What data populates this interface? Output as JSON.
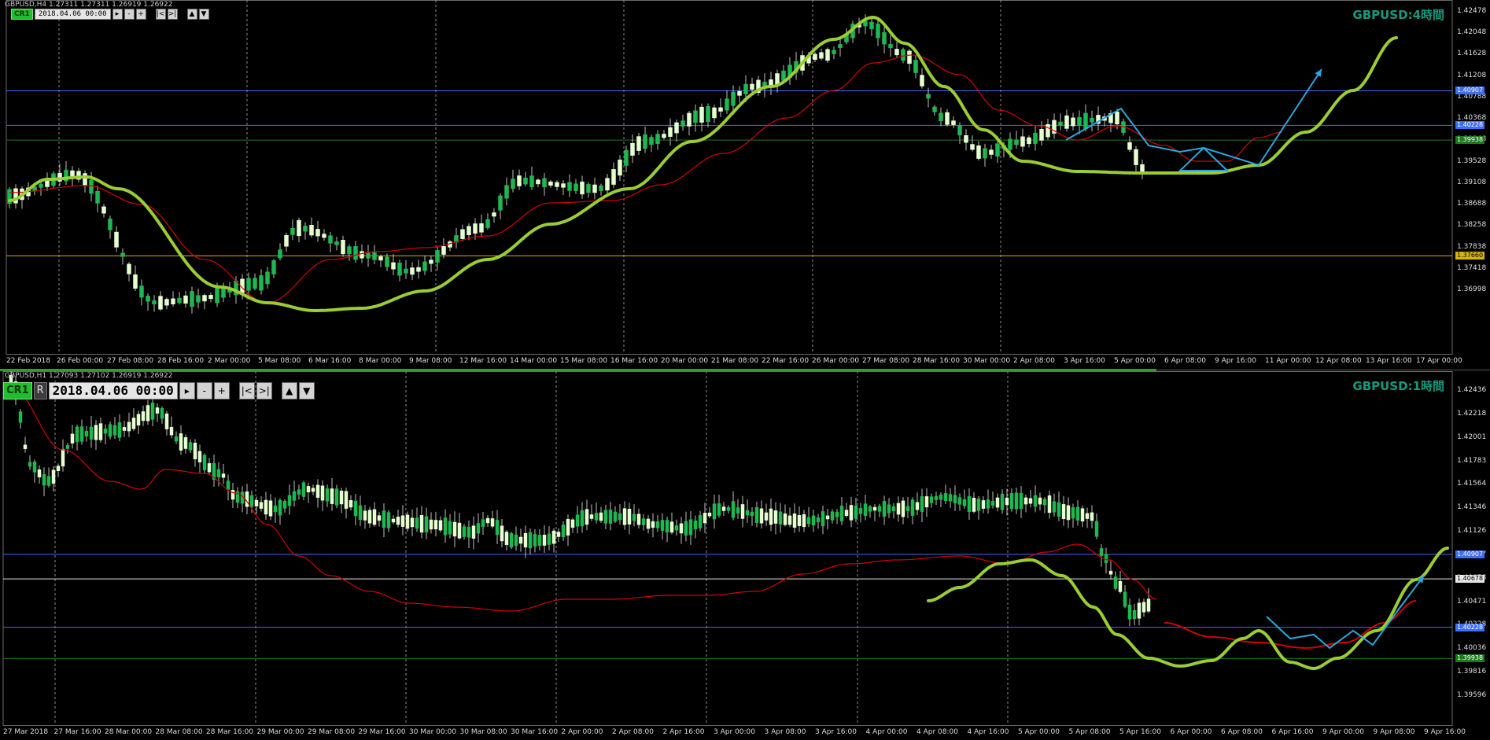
{
  "colors": {
    "background": "#000000",
    "candle_body": "#1db851",
    "candle_wick": "#bfbfbf",
    "candle_bear": "#e6ffd0",
    "ma_red": "#d40000",
    "trend_lime": "#9acd32",
    "projection_blue": "#2aa7df",
    "level_blue": "#3f6ef6",
    "level_green": "#1c7a1c",
    "level_yellow": "#d6b500",
    "level_white": "#e8e8e8",
    "title_teal": "#149a7e",
    "grid": "#8c8c8c"
  },
  "top": {
    "symbol_info": "GBPUSD,H4  1.27311 1.27311 1.26919 1.26922",
    "title": "GBPUSD:4時間",
    "toolbar": {
      "cr": "CR1",
      "date": "2018.04.06 00:00",
      "buttons": [
        "▸",
        "-",
        "+",
        "|<",
        ">|",
        "▲",
        "▼"
      ]
    },
    "y_labels": [
      "1.42478",
      "1.42048",
      "1.41628",
      "1.41208",
      "1.40788",
      "1.40368",
      "1.39948",
      "1.39528",
      "1.39108",
      "1.38688",
      "1.38258",
      "1.37838",
      "1.37418",
      "1.36998"
    ],
    "price_tags": [
      {
        "label": "1.40907",
        "price": 1.40907,
        "color": "#3f6ef6"
      },
      {
        "label": "1.40228",
        "price": 1.40228,
        "color": "#3f6ef6"
      },
      {
        "label": "1.39938",
        "price": 1.39938,
        "color": "#1c7a1c"
      },
      {
        "label": "1.37660",
        "price": 1.3766,
        "color": "#d6b500"
      }
    ],
    "x_labels": [
      "22 Feb 2018",
      "26 Feb 00:00",
      "27 Feb 08:00",
      "28 Feb 16:00",
      "2 Mar 00:00",
      "5 Mar 08:00",
      "6 Mar 16:00",
      "8 Mar 00:00",
      "9 Mar 08:00",
      "12 Mar 16:00",
      "14 Mar 00:00",
      "15 Mar 08:00",
      "16 Mar 16:00",
      "20 Mar 00:00",
      "21 Mar 08:00",
      "22 Mar 16:00",
      "26 Mar 00:00",
      "27 Mar 08:00",
      "28 Mar 16:00",
      "30 Mar 00:00",
      "2 Apr 08:00",
      "3 Apr 16:00",
      "5 Apr 00:00",
      "6 Apr 08:00",
      "9 Apr 16:00",
      "11 Apr 00:00",
      "12 Apr 08:00",
      "13 Apr 16:00",
      "17 Apr 00:00"
    ]
  },
  "bottom": {
    "symbol_info": "GBPUSD,H1  1.27093 1.27102 1.26919 1.26922",
    "title": "GBPUSD:1時間",
    "toolbar": {
      "cr": "CR1",
      "r": "R",
      "date": "2018.04.06 00:00",
      "buttons": [
        "▸",
        "-",
        "+",
        "|<",
        ">|",
        "▲",
        "▼"
      ]
    },
    "y_labels": [
      "1.42436",
      "1.42218",
      "1.42001",
      "1.41783",
      "1.41564",
      "1.41346",
      "1.41126",
      "1.40907",
      "1.40678",
      "1.40471",
      "1.40228",
      "1.40036",
      "1.39816",
      "1.39596"
    ],
    "price_tags": [
      {
        "label": "1.40907",
        "price": 1.40907,
        "color": "#3f6ef6"
      },
      {
        "label": "1.40678",
        "price": 1.40678,
        "color": "#e8e8e8"
      },
      {
        "label": "1.40228",
        "price": 1.40228,
        "color": "#3f6ef6"
      },
      {
        "label": "1.39938",
        "price": 1.39938,
        "color": "#1c7a1c"
      }
    ],
    "x_labels": [
      "27 Mar 2018",
      "27 Mar 16:00",
      "28 Mar 00:00",
      "28 Mar 08:00",
      "28 Mar 16:00",
      "29 Mar 00:00",
      "29 Mar 08:00",
      "29 Mar 16:00",
      "30 Mar 00:00",
      "30 Mar 08:00",
      "30 Mar 16:00",
      "2 Apr 00:00",
      "2 Apr 08:00",
      "2 Apr 16:00",
      "3 Apr 00:00",
      "3 Apr 08:00",
      "3 Apr 16:00",
      "4 Apr 00:00",
      "4 Apr 08:00",
      "4 Apr 16:00",
      "5 Apr 00:00",
      "5 Apr 08:00",
      "5 Apr 16:00",
      "6 Apr 00:00",
      "6 Apr 08:00",
      "6 Apr 16:00",
      "9 Apr 00:00",
      "9 Apr 08:00",
      "9 Apr 16:00"
    ]
  }
}
